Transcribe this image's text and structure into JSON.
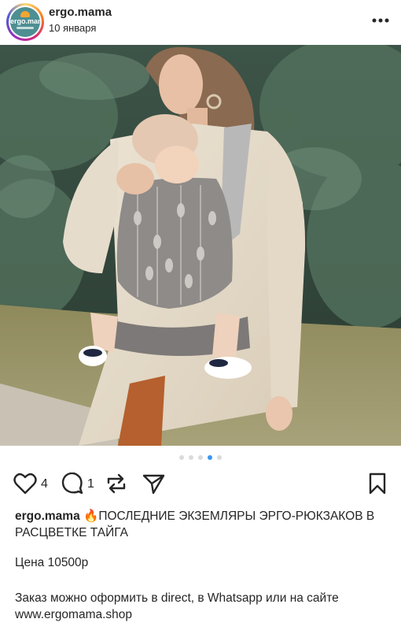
{
  "post": {
    "author": "ergo.mama",
    "date": "10 января",
    "avatar_text": "ergo.mama",
    "image_alt": "Мама с ребёнком в эрго-рюкзаке расцветки Тайга",
    "carousel": {
      "total": 5,
      "active_index": 3
    }
  },
  "actions": {
    "like_count": "4",
    "comment_count": "1",
    "icons": [
      "heart-icon",
      "comment-icon",
      "repost-icon",
      "share-icon",
      "bookmark-icon"
    ]
  },
  "caption": {
    "author": "ergo.mama",
    "emoji": "🔥",
    "text": "ПОСЛЕДНИЕ  ЭКЗЕМЛЯРЫ ЭРГО-РЮКЗАКОВ В РАСЦВЕТКЕ ТАЙГА",
    "price": "Цена 10500р",
    "order": "Заказ можно оформить в direct,  в Whatsapp или на сайте www.ergomama.shop"
  },
  "colors": {
    "accent": "#3897f0",
    "text": "#262626",
    "dot_inactive": "#dbdbdb"
  }
}
